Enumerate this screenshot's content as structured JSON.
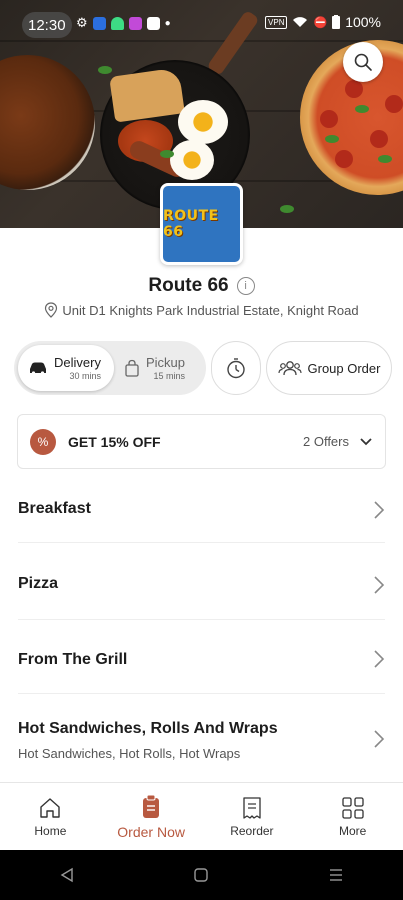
{
  "status_bar": {
    "time": "12:30",
    "vpn_label": "VPN",
    "battery": "100%"
  },
  "restaurant": {
    "logo_text": "ROUTE 66",
    "name": "Route 66",
    "address": "Unit D1 Knights Park Industrial Estate, Knight Road"
  },
  "order_mode": {
    "delivery_label": "Delivery",
    "delivery_time": "30 mins",
    "pickup_label": "Pickup",
    "pickup_time": "15 mins",
    "selected": "Delivery"
  },
  "group_order_label": "Group Order",
  "offers": {
    "title": "GET 15% OFF",
    "count_label": "2 Offers",
    "badge_icon": "percent-icon"
  },
  "categories": [
    {
      "name": "Breakfast",
      "desc": ""
    },
    {
      "name": "Pizza",
      "desc": ""
    },
    {
      "name": "From The Grill",
      "desc": ""
    },
    {
      "name": "Hot Sandwiches, Rolls And Wraps",
      "desc": "Hot Sandwiches, Hot Rolls, Hot Wraps"
    }
  ],
  "bottom_nav": [
    {
      "label": "Home",
      "icon": "home-icon"
    },
    {
      "label": "Order Now",
      "icon": "order-icon"
    },
    {
      "label": "Reorder",
      "icon": "receipt-icon"
    },
    {
      "label": "More",
      "icon": "grid-icon"
    }
  ],
  "colors": {
    "accent": "#b85940",
    "logo_bg": "#2f74c0",
    "logo_text": "#f2c21a"
  }
}
